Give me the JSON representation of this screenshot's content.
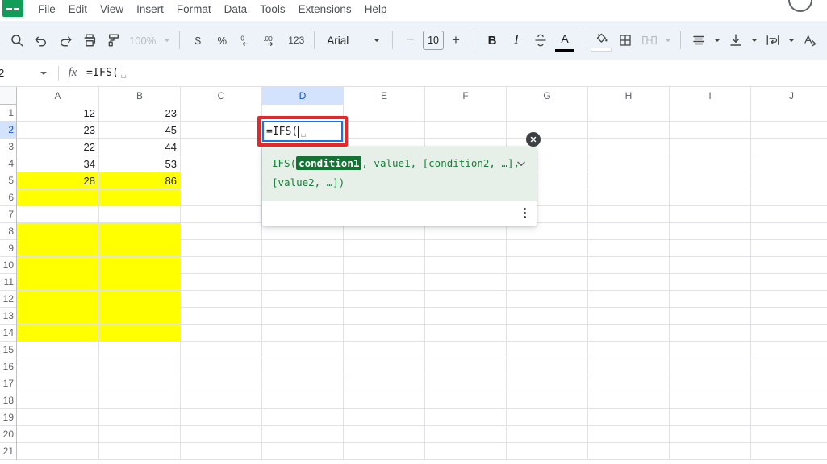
{
  "menubar": {
    "logo_icon": "sheets-logo-icon",
    "items": [
      {
        "label": "File"
      },
      {
        "label": "Edit"
      },
      {
        "label": "View"
      },
      {
        "label": "Insert"
      },
      {
        "label": "Format"
      },
      {
        "label": "Data"
      },
      {
        "label": "Tools"
      },
      {
        "label": "Extensions"
      },
      {
        "label": "Help"
      }
    ]
  },
  "toolbar": {
    "search_icon": "search-icon",
    "undo_icon": "undo-icon",
    "redo_icon": "redo-icon",
    "print_icon": "print-icon",
    "paint_format_icon": "paint-format-icon",
    "zoom_value": "100%",
    "currency_label": "$",
    "percent_label": "%",
    "decrease_decimal_icon": "decrease-decimal-icon",
    "decrease_decimal_label": ".0",
    "increase_decimal_icon": "increase-decimal-icon",
    "increase_decimal_label": ".00",
    "more_formats_label": "123",
    "font_name": "Arial",
    "font_size": "10",
    "decrease_font_label": "−",
    "increase_font_label": "+",
    "bold_label": "B",
    "italic_label": "I",
    "strikethrough_icon": "strikethrough-icon",
    "text_color_label": "A",
    "fill_color_icon": "fill-color-icon",
    "borders_icon": "borders-icon",
    "merge_cells_icon": "merge-cells-icon",
    "horizontal_align_icon": "horizontal-align-icon",
    "vertical_align_icon": "vertical-align-icon",
    "text_wrap_icon": "text-wrap-icon",
    "text_rotation_icon": "text-rotation-icon"
  },
  "formula_bar": {
    "name_box_value": "2",
    "fx_label": "fx",
    "formula_value": "=IFS("
  },
  "grid": {
    "columns": [
      "A",
      "B",
      "C",
      "D",
      "E",
      "F",
      "G",
      "H",
      "I",
      "J"
    ],
    "active_column": "D",
    "active_row": "2",
    "rows": [
      {
        "num": "1",
        "cells": [
          "12",
          "23",
          "",
          "",
          "",
          "",
          "",
          "",
          "",
          ""
        ]
      },
      {
        "num": "2",
        "cells": [
          "23",
          "45",
          "",
          "",
          "",
          "",
          "",
          "",
          "",
          ""
        ]
      },
      {
        "num": "3",
        "cells": [
          "22",
          "44",
          "",
          "",
          "",
          "",
          "",
          "",
          "",
          ""
        ]
      },
      {
        "num": "4",
        "cells": [
          "34",
          "53",
          "",
          "",
          "",
          "",
          "",
          "",
          "",
          ""
        ]
      },
      {
        "num": "5",
        "cells": [
          "28",
          "86",
          "",
          "",
          "",
          "",
          "",
          "",
          "",
          ""
        ]
      },
      {
        "num": "6",
        "cells": [
          "",
          "",
          "",
          "",
          "",
          "",
          "",
          "",
          "",
          ""
        ]
      },
      {
        "num": "7",
        "cells": [
          "",
          "",
          "",
          "",
          "",
          "",
          "",
          "",
          "",
          ""
        ]
      },
      {
        "num": "8",
        "cells": [
          "",
          "",
          "",
          "",
          "",
          "",
          "",
          "",
          "",
          ""
        ]
      },
      {
        "num": "9",
        "cells": [
          "",
          "",
          "",
          "",
          "",
          "",
          "",
          "",
          "",
          ""
        ]
      },
      {
        "num": "10",
        "cells": [
          "",
          "",
          "",
          "",
          "",
          "",
          "",
          "",
          "",
          ""
        ]
      },
      {
        "num": "11",
        "cells": [
          "",
          "",
          "",
          "",
          "",
          "",
          "",
          "",
          "",
          ""
        ]
      },
      {
        "num": "12",
        "cells": [
          "",
          "",
          "",
          "",
          "",
          "",
          "",
          "",
          "",
          ""
        ]
      },
      {
        "num": "13",
        "cells": [
          "",
          "",
          "",
          "",
          "",
          "",
          "",
          "",
          "",
          ""
        ]
      },
      {
        "num": "14",
        "cells": [
          "",
          "",
          "",
          "",
          "",
          "",
          "",
          "",
          "",
          ""
        ]
      },
      {
        "num": "15",
        "cells": [
          "",
          "",
          "",
          "",
          "",
          "",
          "",
          "",
          "",
          ""
        ]
      },
      {
        "num": "16",
        "cells": [
          "",
          "",
          "",
          "",
          "",
          "",
          "",
          "",
          "",
          ""
        ]
      },
      {
        "num": "17",
        "cells": [
          "",
          "",
          "",
          "",
          "",
          "",
          "",
          "",
          "",
          ""
        ]
      },
      {
        "num": "18",
        "cells": [
          "",
          "",
          "",
          "",
          "",
          "",
          "",
          "",
          "",
          ""
        ]
      },
      {
        "num": "19",
        "cells": [
          "",
          "",
          "",
          "",
          "",
          "",
          "",
          "",
          "",
          ""
        ]
      },
      {
        "num": "20",
        "cells": [
          "",
          "",
          "",
          "",
          "",
          "",
          "",
          "",
          "",
          ""
        ]
      },
      {
        "num": "21",
        "cells": [
          "",
          "",
          "",
          "",
          "",
          "",
          "",
          "",
          "",
          ""
        ]
      }
    ],
    "yellow_fill_rows": [
      5,
      6,
      8,
      9,
      10,
      11,
      12,
      13,
      14
    ],
    "yellow_fill_columns": [
      "A",
      "B"
    ],
    "fill_color": "#ffff00"
  },
  "cell_editor": {
    "value": "=IFS(",
    "highlight_color": "#e8262a",
    "border_color": "#1a73e8"
  },
  "autocomplete": {
    "signature_prefix": "IFS(",
    "token": "condition1",
    "signature_rest": ", value1, [condition2, …],",
    "signature_line2": "[value2, …])",
    "chevron_icon": "chevron-down-icon",
    "close_icon": "close-icon",
    "more_icon": "more-vertical-icon",
    "background": "#e6f0e9",
    "token_background": "#137333"
  }
}
